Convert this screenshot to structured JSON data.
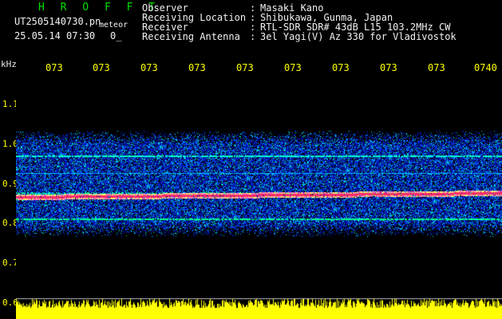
{
  "header": {
    "logo": "H R O F F T",
    "filename": "UT2505140730.pn",
    "subtitle": "meteor",
    "datetime": "25.05.14 07:30",
    "code": "0_",
    "info": [
      {
        "label": "Observer",
        "value": "Masaki Kano"
      },
      {
        "label": "Receiving Location",
        "value": "Shibukawa, Gunma, Japan"
      },
      {
        "label": "Receiver",
        "value": "RTL-SDR SDR# 43dB L15 103.2MHz CW"
      },
      {
        "label": "Receiving Antenna",
        "value": "3el Yagi(V) Az 330 for Vladivostok"
      }
    ]
  },
  "axis": {
    "unit": "kHz",
    "time_ticks": [
      "073",
      "073",
      "073",
      "073",
      "073",
      "073",
      "073",
      "073",
      "073",
      "0740"
    ],
    "freq_ticks": [
      "1.1",
      "1.0",
      "0.9",
      "0.8",
      "0.7",
      "0.6"
    ]
  },
  "colors": {
    "header_text": "#f2f2f2",
    "logo": "#00e000",
    "ticks": "#ffff00",
    "carrier": "#ff2a6a",
    "noise_floor": "#ffff00",
    "background": "#000000"
  }
}
